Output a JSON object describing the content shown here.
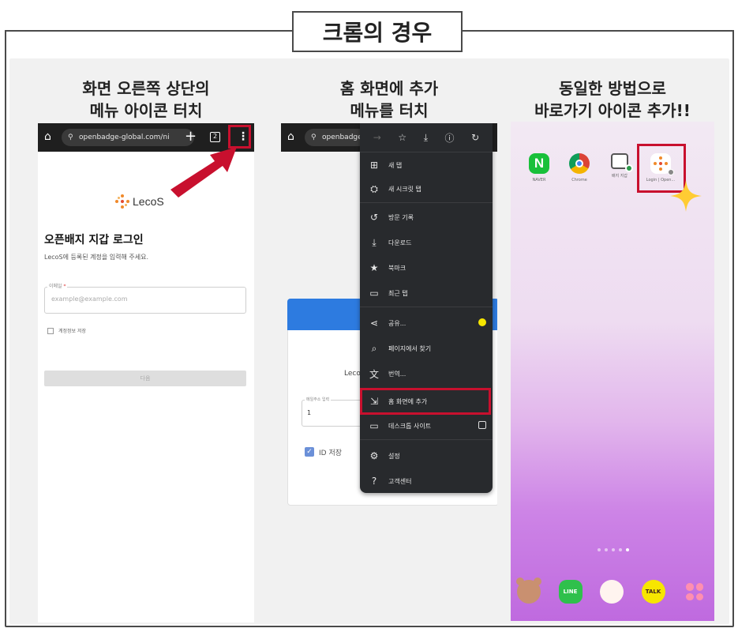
{
  "header": {
    "title": "크롬의 경우"
  },
  "steps": [
    {
      "caption_line1": "화면 오른쪽 상단의",
      "caption_line2": "메뉴 아이콘 터치"
    },
    {
      "caption_line1": "홈 화면에 추가",
      "caption_line2": "메뉴를 터치"
    },
    {
      "caption_line1": "동일한 방법으로",
      "caption_line2": "바로가기 아이콘 추가!!"
    }
  ],
  "panel1": {
    "url": "openbadge-global.com/ni",
    "tab_count": "2",
    "brand": "LecoS",
    "login_title": "오픈배지 지갑 로그인",
    "login_subtitle": "LecoS에 등록된 계정을 입력해 주세요.",
    "email_label": "이메일",
    "required_mark": "*",
    "email_placeholder": "example@example.com",
    "remember_label": "계정정보 저장",
    "submit_label": "다음"
  },
  "panel2": {
    "url": "openbadge",
    "brand": "Leco",
    "email_label": "메일주소 입력",
    "email_value": "1",
    "id_save_label": "ID 저장",
    "menu": {
      "items": [
        {
          "icon": "new-tab-icon",
          "glyph": "⊞",
          "label": "새 탭"
        },
        {
          "icon": "incognito-icon",
          "glyph": "⛭",
          "label": "새 시크릿 탭"
        },
        {
          "icon": "history-icon",
          "glyph": "↺",
          "label": "방문 기록"
        },
        {
          "icon": "download-icon",
          "glyph": "⤓",
          "label": "다운로드"
        },
        {
          "icon": "bookmark-star-icon",
          "glyph": "★",
          "label": "북마크"
        },
        {
          "icon": "recent-tabs-icon",
          "glyph": "▭",
          "label": "최근 탭"
        },
        {
          "icon": "share-icon",
          "glyph": "⋖",
          "label": "공유..."
        },
        {
          "icon": "find-in-page-icon",
          "glyph": "⌕",
          "label": "페이지에서 찾기"
        },
        {
          "icon": "translate-icon",
          "glyph": "文",
          "label": "번역..."
        },
        {
          "icon": "add-to-home-icon",
          "glyph": "⇲",
          "label": "홈 화면에 추가"
        },
        {
          "icon": "desktop-site-icon",
          "glyph": "▭",
          "label": "데스크톱 사이트"
        },
        {
          "icon": "settings-gear-icon",
          "glyph": "⚙",
          "label": "설정"
        },
        {
          "icon": "help-icon",
          "glyph": "?",
          "label": "고객센터"
        }
      ]
    }
  },
  "panel3": {
    "apps": [
      {
        "name": "naver",
        "icon_text": "N",
        "label": "NAVER"
      },
      {
        "name": "chrome",
        "icon_text": "",
        "label": "Chrome"
      },
      {
        "name": "wallet",
        "icon_text": "",
        "label": "배지 지갑"
      },
      {
        "name": "lecos",
        "icon_text": "",
        "label": "Login | Open..."
      }
    ],
    "dock": [
      {
        "name": "bear"
      },
      {
        "name": "line",
        "text": "LINE"
      },
      {
        "name": "cony"
      },
      {
        "name": "kakaotalk",
        "text": "TALK"
      },
      {
        "name": "grid"
      }
    ]
  },
  "colors": {
    "highlight_red": "#c8102e",
    "toolbar_dark": "#1f1f1f",
    "menu_dark": "#282a2d",
    "lecos_orange": "#f0892a",
    "lecos_red": "#e34a2f",
    "naver_green": "#19c03a",
    "kakao_yellow": "#f7e600"
  }
}
